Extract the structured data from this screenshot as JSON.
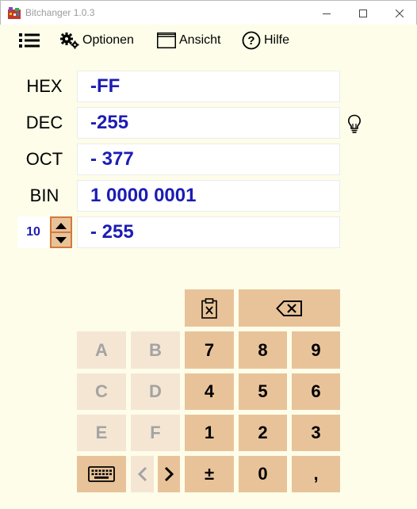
{
  "window": {
    "title": "Bitchanger 1.0.3"
  },
  "menu": {
    "options_label": "Optionen",
    "view_label": "Ansicht",
    "help_label": "Hilfe",
    "help_glyph": "?"
  },
  "rows": {
    "hex": {
      "label": "HEX",
      "value": "-FF"
    },
    "dec": {
      "label": "DEC",
      "value": "-255"
    },
    "oct": {
      "label": "OCT",
      "value": "- 377"
    },
    "bin": {
      "label": "BIN",
      "value": "1 0000 0001"
    },
    "custom": {
      "base": "10",
      "value": "- 255"
    }
  },
  "keypad": {
    "a": "A",
    "b": "B",
    "c": "C",
    "d": "D",
    "e": "E",
    "f": "F",
    "n7": "7",
    "n8": "8",
    "n9": "9",
    "n4": "4",
    "n5": "5",
    "n6": "6",
    "n1": "1",
    "n2": "2",
    "n3": "3",
    "sign": "±",
    "n0": "0",
    "comma": ","
  },
  "icons": {
    "menu": "list-icon",
    "options": "gears-icon",
    "view": "window-icon",
    "help": "help-circle-icon",
    "tip": "lightbulb-icon",
    "clear": "clear-clipboard-icon",
    "backspace": "backspace-icon",
    "keyboard": "keyboard-icon",
    "cursor_left": "chevron-left-icon",
    "cursor_right": "chevron-right-icon"
  },
  "colors": {
    "background": "#fdfde9",
    "value_text": "#1c1cb5",
    "key_active": "#e8c39a",
    "key_disabled": "#f5e6d3",
    "spinner_border": "#d27a3b"
  }
}
